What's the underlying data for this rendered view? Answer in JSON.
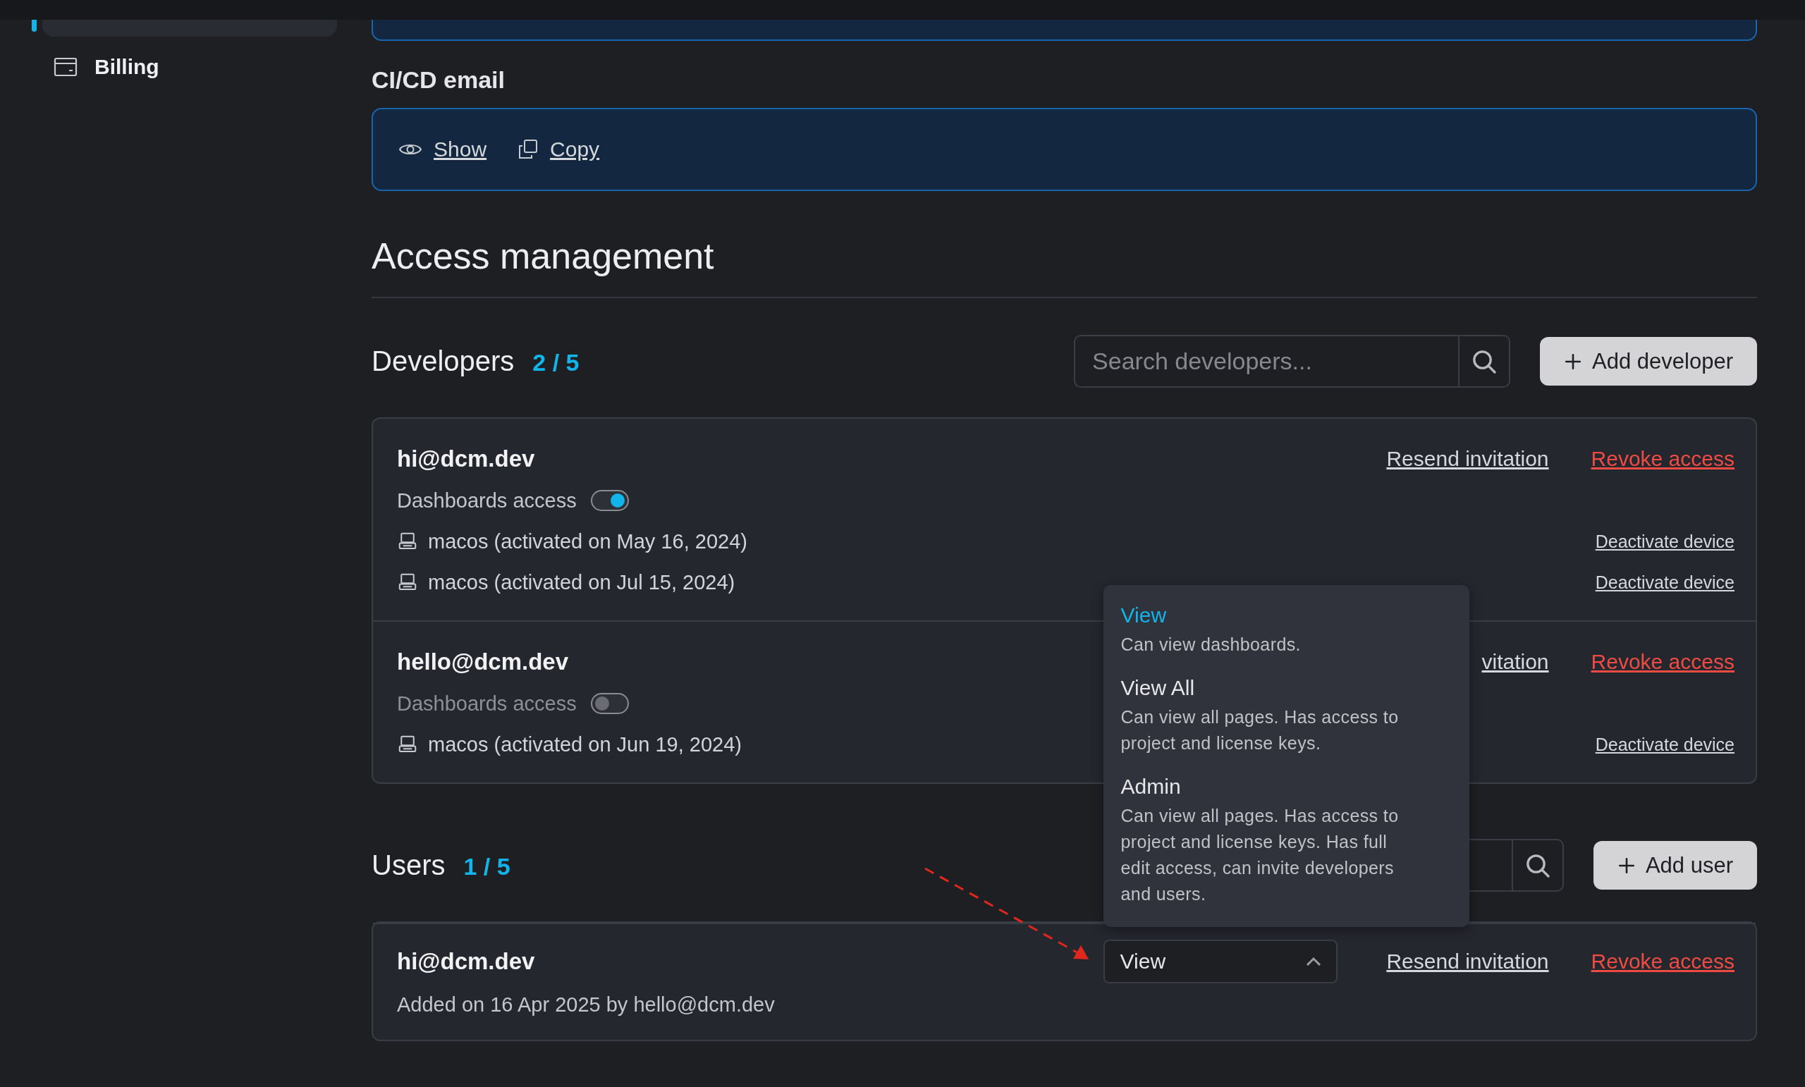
{
  "sidebar": {
    "items": [
      {
        "selected": true
      },
      {
        "label": "Billing",
        "selected": false
      }
    ]
  },
  "ci_cd": {
    "title": "CI/CD email",
    "actions": [
      {
        "kind": "show",
        "label": "Show"
      },
      {
        "kind": "copy",
        "label": "Copy"
      }
    ]
  },
  "access": {
    "title": "Access management"
  },
  "developers": {
    "title": "Developers",
    "count": "2 / 5",
    "search": {
      "placeholder": "Search developers..."
    },
    "add_button": "Add developer",
    "members": [
      {
        "email": "hi@dcm.dev",
        "dashboards_label": "Dashboards access",
        "dashboards_access": true,
        "actions": [
          {
            "kind": "resend",
            "label": "Resend invitation"
          },
          {
            "kind": "revoke",
            "label": "Revoke access"
          }
        ],
        "devices": [
          {
            "label": "macos (activated on May 16, 2024)",
            "action": "Deactivate device"
          },
          {
            "label": "macos (activated on Jul 15, 2024)",
            "action": "Deactivate device"
          }
        ]
      },
      {
        "email": "hello@dcm.dev",
        "dashboards_label": "Dashboards access",
        "dashboards_access": false,
        "actions": [
          {
            "kind": "resend",
            "label": "vitation"
          },
          {
            "kind": "revoke",
            "label": "Revoke access"
          }
        ],
        "devices": [
          {
            "label": "macos (activated on Jun 19, 2024)",
            "action": "Deactivate device"
          }
        ]
      }
    ]
  },
  "users": {
    "title": "Users",
    "count": "1 / 5",
    "add_button": "Add user",
    "members": [
      {
        "email": "hi@dcm.dev",
        "added": "Added on 16 Apr 2025 by hello@dcm.dev",
        "role": "View",
        "role_open": true,
        "actions": [
          {
            "kind": "resend",
            "label": "Resend invitation"
          },
          {
            "kind": "revoke",
            "label": "Revoke access"
          }
        ]
      }
    ]
  },
  "role_menu": {
    "options": [
      {
        "label": "View",
        "description": "Can view dashboards.",
        "selected": true
      },
      {
        "label": "View All",
        "description": "Can view all pages. Has access to project and license keys.",
        "selected": false
      },
      {
        "label": "Admin",
        "description": "Can view all pages. Has access to project and license keys. Has full edit access, can invite developers and users.",
        "selected": false
      }
    ]
  }
}
